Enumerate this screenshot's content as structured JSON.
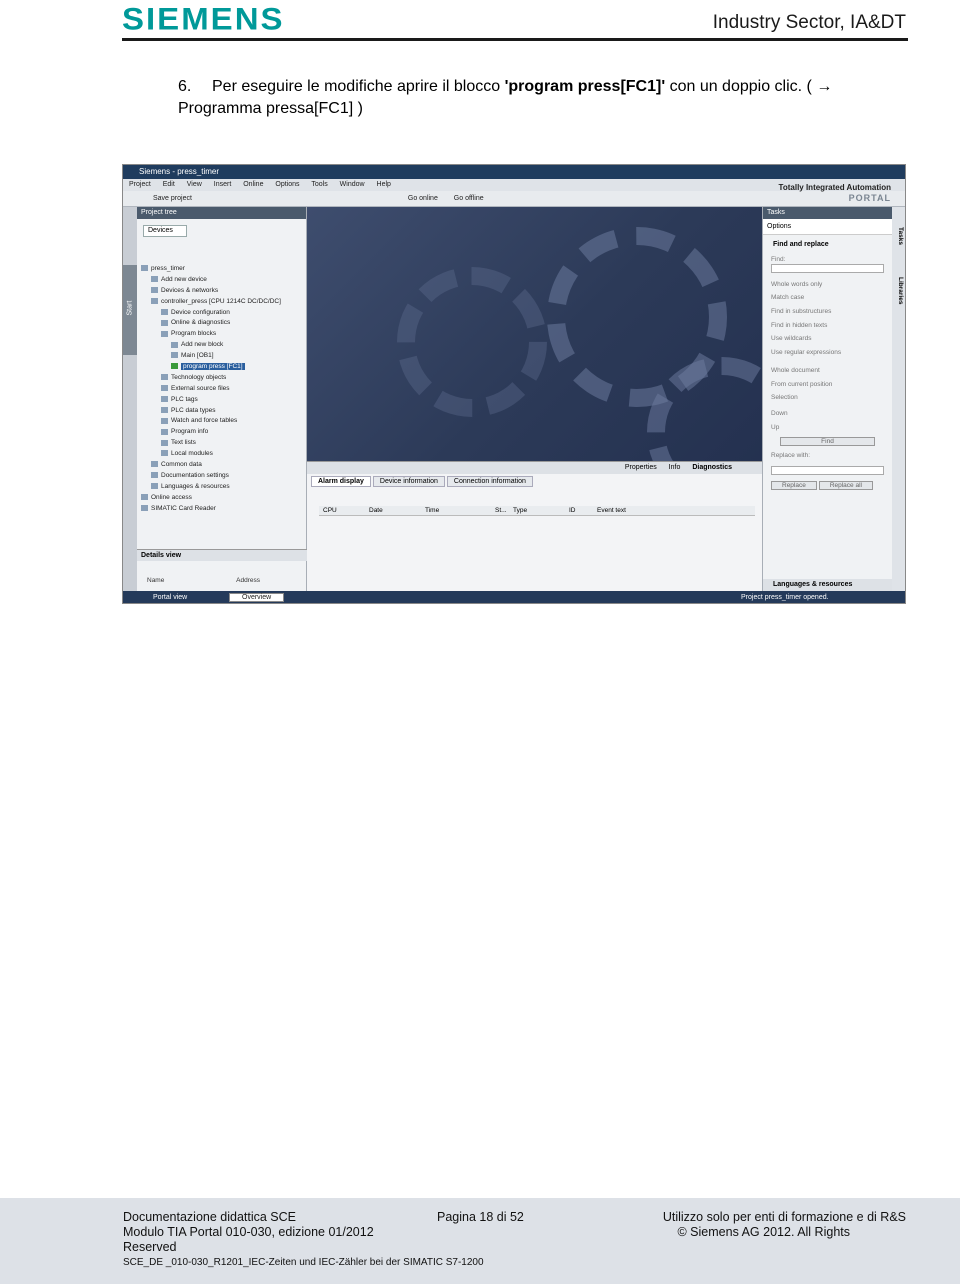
{
  "header": {
    "logo": "SIEMENS",
    "sector": "Industry Sector, IA&DT"
  },
  "step": {
    "number": "6.",
    "line1": "Per eseguire le modifiche aprire il blocco ",
    "bold": "'program press[FC1]'",
    "line1_end": " con un doppio clic. ( →",
    "line2": "Programma pressa[FC1] )"
  },
  "screenshot": {
    "title": "Siemens  -  press_timer",
    "menu": [
      "Project",
      "Edit",
      "View",
      "Insert",
      "Online",
      "Options",
      "Tools",
      "Window",
      "Help"
    ],
    "toolbar": [
      "Save project",
      "Go online",
      "Go offline"
    ],
    "portal1": "Totally Integrated Automation",
    "portal2": "PORTAL",
    "project_tree": "Project tree",
    "devices_tab": "Devices",
    "start": "Start",
    "tree": [
      "press_timer",
      "Add new device",
      "Devices & networks",
      "controller_press [CPU 1214C DC/DC/DC]",
      "Device configuration",
      "Online & diagnostics",
      "Program blocks",
      "Add new block",
      "Main [OB1]",
      "program press [FC1]",
      "Technology objects",
      "External source files",
      "PLC tags",
      "PLC data types",
      "Watch and force tables",
      "Program info",
      "Text lists",
      "Local modules",
      "Common data",
      "Documentation settings",
      "Languages & resources",
      "Online access",
      "SIMATIC Card Reader"
    ],
    "details_view": "Details view",
    "col_name": "Name",
    "col_address": "Address",
    "bottom_tabs": [
      "Properties",
      "Info",
      "Diagnostics"
    ],
    "alarm_tabs": [
      "Alarm display",
      "Device information",
      "Connection information"
    ],
    "alarm_cols": [
      "CPU",
      "Date",
      "Time",
      "St...",
      "Type",
      "ID",
      "Event text"
    ],
    "tasks": "Tasks",
    "options": "Options",
    "find_replace": "Find and replace",
    "find": "Find:",
    "find_opts": [
      "Whole words only",
      "Match case",
      "Find in substructures",
      "Find in hidden texts",
      "Use wildcards",
      "Use regular expressions"
    ],
    "scope": [
      "Whole document",
      "From current position",
      "Selection"
    ],
    "direction": [
      "Down",
      "Up"
    ],
    "find_btn": "Find",
    "replace_with": "Replace with:",
    "replace_btn": "Replace",
    "replace_all_btn": "Replace all",
    "languages": "Languages & resources",
    "side_tabs": [
      "Tasks",
      "Libraries"
    ],
    "portal_view": "Portal view",
    "overview": "Overview",
    "status": "Project press_timer opened."
  },
  "footer": {
    "doc": "Documentazione didattica SCE",
    "page": "Pagina 18 di  52",
    "usage": "Utilizzo solo per enti di formazione e di R&S",
    "module": "Modulo TIA Portal 010-030, edizione 01/2012",
    "copyright": "© Siemens AG 2012. All Rights",
    "reserved": "Reserved",
    "file": "SCE_DE _010-030_R1201_IEC-Zeiten und IEC-Zähler bei der SIMATIC S7-1200"
  }
}
